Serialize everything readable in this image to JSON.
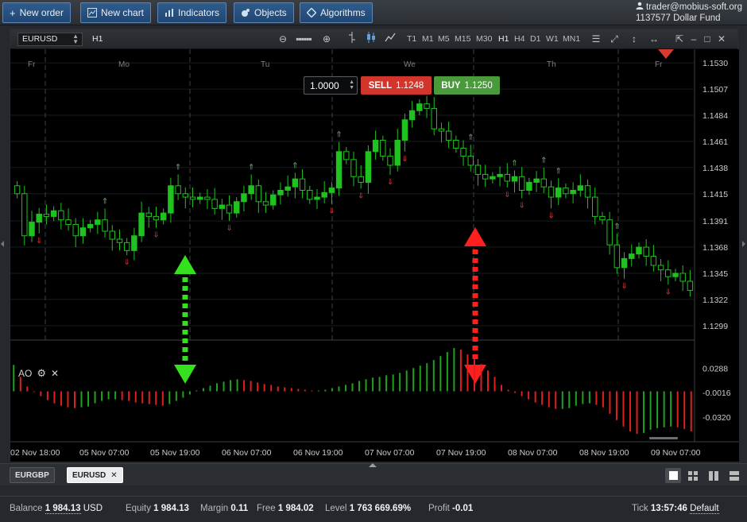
{
  "toolbar": {
    "new_order": "New order",
    "new_chart": "New chart",
    "indicators": "Indicators",
    "objects": "Objects",
    "algorithms": "Algorithms"
  },
  "account": {
    "email": "trader@mobius-soft.org",
    "id_and_fund": "1137577  Dollar Fund"
  },
  "chart": {
    "symbol": "EURUSD",
    "timeframe": "H1",
    "timeframes": [
      "T1",
      "M1",
      "M5",
      "M15",
      "M30",
      "H1",
      "H4",
      "D1",
      "W1",
      "MN1"
    ],
    "active_timeframe": "H1",
    "quantity": "1.0000",
    "sell_label": "SELL",
    "sell_price": "1.1248",
    "buy_label": "BUY",
    "buy_price": "1.1250",
    "day_labels": [
      "Fr",
      "Mo",
      "Tu",
      "We",
      "Th",
      "Fr"
    ],
    "indicator_label": "AO",
    "colors": {
      "sell": "#d2352c",
      "buy": "#4a9a3b",
      "bull": "#1fc21f",
      "bear": "#e02020"
    }
  },
  "chart_data": [
    {
      "type": "candlestick",
      "symbol": "EURUSD",
      "timeframe": "H1",
      "y_ticks": [
        "1.1530",
        "1.1507",
        "1.1484",
        "1.1461",
        "1.1438",
        "1.1415",
        "1.1391",
        "1.1368",
        "1.1345",
        "1.1322",
        "1.1299"
      ],
      "x_ticks": [
        "02 Nov 18:00",
        "05 Nov 07:00",
        "05 Nov 19:00",
        "06 Nov 07:00",
        "06 Nov 19:00",
        "07 Nov 07:00",
        "07 Nov 19:00",
        "08 Nov 07:00",
        "08 Nov 19:00",
        "09 Nov 07:00"
      ],
      "ylim": [
        1.1287,
        1.1542
      ],
      "close": [
        1.1415,
        1.1378,
        1.139,
        1.1397,
        1.1395,
        1.14,
        1.1392,
        1.1388,
        1.1378,
        1.1385,
        1.1388,
        1.1392,
        1.1382,
        1.1375,
        1.1372,
        1.1365,
        1.1378,
        1.1398,
        1.1395,
        1.1392,
        1.1398,
        1.1422,
        1.1415,
        1.1412,
        1.141,
        1.1412,
        1.141,
        1.1402,
        1.1405,
        1.1398,
        1.1408,
        1.1415,
        1.1422,
        1.1408,
        1.1405,
        1.1414,
        1.1418,
        1.1421,
        1.1428,
        1.1418,
        1.141,
        1.1412,
        1.1416,
        1.142,
        1.1452,
        1.1445,
        1.143,
        1.1425,
        1.1452,
        1.1462,
        1.1448,
        1.144,
        1.1462,
        1.148,
        1.1488,
        1.1494,
        1.149,
        1.1472,
        1.147,
        1.1462,
        1.1455,
        1.1448,
        1.144,
        1.1432,
        1.1428,
        1.143,
        1.1432,
        1.1426,
        1.143,
        1.1418,
        1.1425,
        1.1428,
        1.1421,
        1.1412,
        1.142,
        1.1415,
        1.1418,
        1.1422,
        1.1412,
        1.1395,
        1.1392,
        1.137,
        1.135,
        1.1358,
        1.1362,
        1.1368,
        1.136,
        1.1352,
        1.1348,
        1.1342,
        1.1345,
        1.1338,
        1.133
      ]
    },
    {
      "type": "bar",
      "name": "AO",
      "y_ticks": [
        "0.0288",
        "-0.0016",
        "-0.0320"
      ],
      "ylim": [
        -0.063,
        0.062
      ],
      "values": [
        0.033,
        0.018,
        0.006,
        -0.001,
        -0.006,
        -0.011,
        -0.015,
        -0.018,
        -0.02,
        -0.021,
        -0.02,
        -0.019,
        -0.015,
        -0.012,
        -0.01,
        -0.01,
        -0.011,
        -0.012,
        -0.014,
        -0.015,
        -0.016,
        -0.017,
        -0.018,
        -0.016,
        -0.012,
        -0.008,
        -0.004,
        0.001,
        0.004,
        0.007,
        0.01,
        0.012,
        0.014,
        0.015,
        0.014,
        0.013,
        0.011,
        0.009,
        0.008,
        0.006,
        0.005,
        0.004,
        0.003,
        0.002,
        0.001,
        0.001,
        0.002,
        0.004,
        0.006,
        0.008,
        0.01,
        0.013,
        0.015,
        0.017,
        0.018,
        0.02,
        0.021,
        0.023,
        0.026,
        0.029,
        0.032,
        0.035,
        0.039,
        0.044,
        0.049,
        0.054,
        0.052,
        0.046,
        0.04,
        0.034,
        0.026,
        0.018,
        0.008,
        0.002,
        -0.002,
        -0.006,
        -0.01,
        -0.014,
        -0.017,
        -0.02,
        -0.022,
        -0.022,
        -0.021,
        -0.018,
        -0.016,
        -0.015,
        -0.017,
        -0.02,
        -0.028,
        -0.036,
        -0.044,
        -0.05,
        -0.053,
        -0.052,
        -0.048,
        -0.046,
        -0.045,
        -0.044,
        -0.045,
        -0.047,
        -0.05
      ]
    }
  ],
  "tabs": [
    {
      "label": "EURGBP"
    },
    {
      "label": "EURUSD"
    }
  ],
  "status": {
    "balance_label": "Balance",
    "balance_value": "1 984.13",
    "balance_currency": "USD",
    "equity_label": "Equity",
    "equity_value": "1 984.13",
    "margin_label": "Margin",
    "margin_value": "0.11",
    "free_label": "Free",
    "free_value": "1 984.02",
    "level_label": "Level",
    "level_value": "1 763 669.69%",
    "profit_label": "Profit",
    "profit_value": "-0.01",
    "tick_label": "Tick",
    "tick_value": "13:57:46",
    "tick_mode": "Default"
  }
}
